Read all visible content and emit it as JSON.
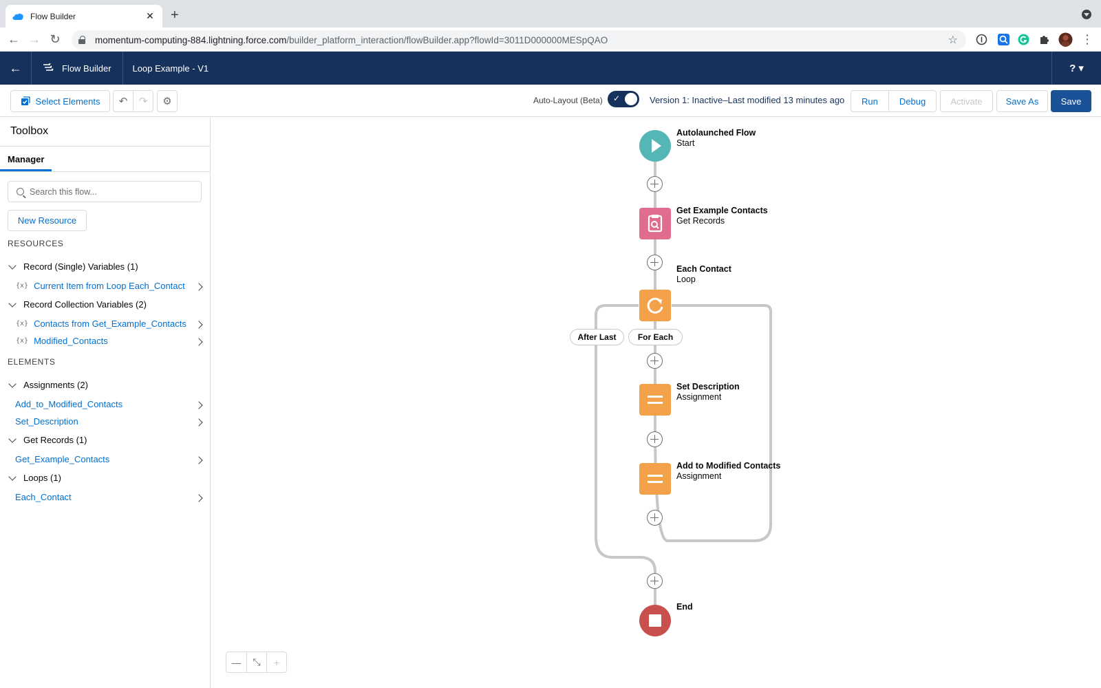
{
  "browser": {
    "tab_title": "Flow Builder",
    "tab_close": "✕",
    "new_tab": "+",
    "url_host": "momentum-computing-884.lightning.force.com",
    "url_path": "/builder_platform_interaction/flowBuilder.app?flowId=3011D000000MESpQAO"
  },
  "header": {
    "app_name": "Flow Builder",
    "flow_title": "Loop Example - V1",
    "help_label": "? ▾"
  },
  "toolbar": {
    "select_elements": "Select Elements",
    "auto_layout_label": "Auto-Layout (Beta)",
    "auto_layout_on": true,
    "version_status": "Version 1: Inactive–Last modified 13 minutes ago",
    "run": "Run",
    "debug": "Debug",
    "activate": "Activate",
    "save_as": "Save As",
    "save": "Save"
  },
  "sidebar": {
    "title": "Toolbox",
    "tab": "Manager",
    "search_placeholder": "Search this flow...",
    "new_resource": "New Resource",
    "resources_heading": "RESOURCES",
    "elements_heading": "ELEMENTS",
    "var_icon": "{x}",
    "groups": [
      {
        "label": "Record (Single) Variables (1)",
        "items": [
          "Current Item from Loop Each_Contact"
        ]
      },
      {
        "label": "Record Collection Variables (2)",
        "items": [
          "Contacts from Get_Example_Contacts",
          "Modified_Contacts"
        ]
      },
      {
        "label": "Assignments (2)",
        "items": [
          "Add_to_Modified_Contacts",
          "Set_Description"
        ]
      },
      {
        "label": "Get Records (1)",
        "items": [
          "Get_Example_Contacts"
        ]
      },
      {
        "label": "Loops (1)",
        "items": [
          "Each_Contact"
        ]
      }
    ]
  },
  "canvas": {
    "nodes": [
      {
        "title": "Autolaunched Flow",
        "subtitle": "Start",
        "icon": "play-icon",
        "color": "#54b6b5"
      },
      {
        "title": "Get Example Contacts",
        "subtitle": "Get Records",
        "icon": "record-lookup-icon",
        "color": "#e16d8e"
      },
      {
        "title": "Each Contact",
        "subtitle": "Loop",
        "icon": "loop-icon",
        "color": "#f4a24a"
      },
      {
        "title": "Set Description",
        "subtitle": "Assignment",
        "icon": "assignment-icon",
        "color": "#f4a24a"
      },
      {
        "title": "Add to Modified Contacts",
        "subtitle": "Assignment",
        "icon": "assignment-icon",
        "color": "#f4a24a"
      },
      {
        "title": "End",
        "subtitle": "",
        "icon": "stop-icon",
        "color": "#c8514e"
      }
    ],
    "branch_after_last": "After Last",
    "branch_for_each": "For Each",
    "zoom_out": "—",
    "fit": "⤡",
    "zoom_in": "+"
  },
  "colors": {
    "header_bg": "#16325c",
    "brand_button": "#1b5297",
    "link": "#0070d2"
  }
}
